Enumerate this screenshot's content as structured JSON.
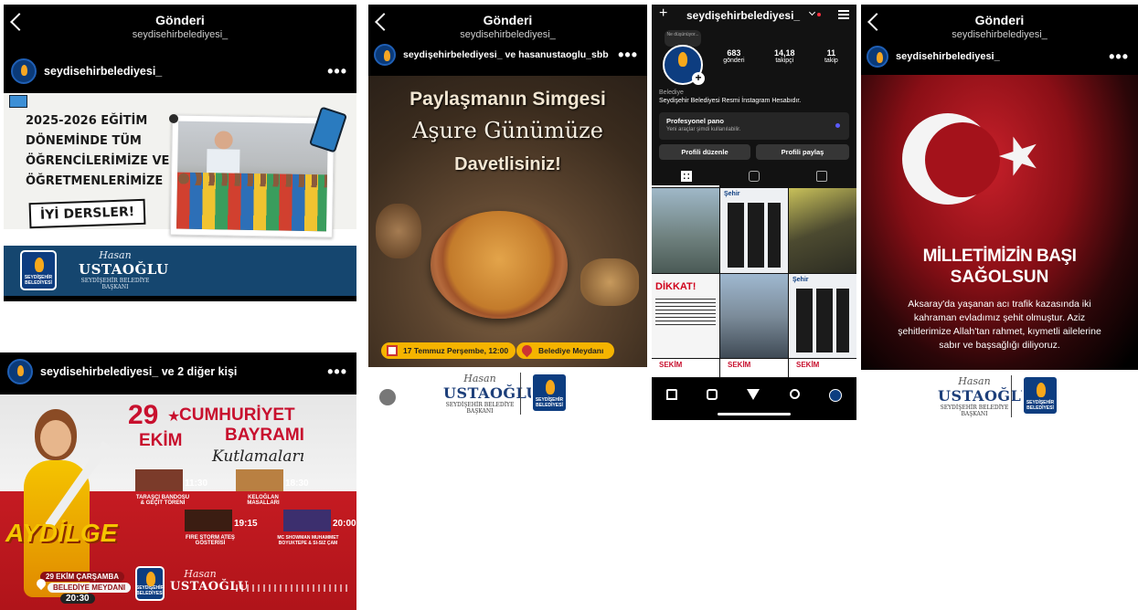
{
  "panel1": {
    "header_title": "Gönderi",
    "header_sub": "seydisehirbelediyesi_",
    "username": "seydisehirbelediyesi_",
    "more": "•••",
    "headline": [
      "2025-2026 EĞİTİM",
      "DÖNEMİNDE TÜM",
      "ÖĞRENCİLERİMİZE VE",
      "ÖĞRETMENLERİMİZE"
    ],
    "banner": "İYİ DERSLER!",
    "logo_text": "SEYDİŞEHİR BELEDİYESİ",
    "sig_hand": "Hasan",
    "sig_name": "USTAOĞLU",
    "sig_title": "SEYDİŞEHİR BELEDİYE BAŞKANI"
  },
  "panel2": {
    "username": "seydisehirbelediyesi_ ve 2 diğer kişi",
    "more": "•••",
    "day": "29",
    "month": "EKİM",
    "title1": "CUMHURİYET",
    "title2": "BAYRAMI",
    "title3": "Kutlamaları",
    "events": [
      {
        "time": "11:30",
        "name": "TARAŞÇI BANDOSU & GEÇİT TÖRENİ"
      },
      {
        "time": "18:30",
        "name": "KELOĞLAN MASALLARI"
      },
      {
        "time": "19:15",
        "name": "FIRE STORM ATEŞ GÖSTERİSİ"
      },
      {
        "time": "20:00",
        "name": "MC SHOWMAN MUHAMMET BOYUKTEPE & SI-SIZ ÇAM"
      }
    ],
    "artist": "AYDİLGE",
    "date_line": "29 EKİM ÇARŞAMBA",
    "place_line": "BELEDİYE MEYDANI",
    "start_time": "20:30",
    "logo_text": "SEYDİŞEHİR BELEDİYESİ",
    "sig_hand": "Hasan",
    "sig_name": "USTAOĞLU"
  },
  "panel3": {
    "header_title": "Gönderi",
    "header_sub": "seydisehirbelediyesi_",
    "username": "seydişehirbelediyesi_ ve hasanustaoglu_sbb",
    "more": "•••",
    "title1": "Paylaşmanın Simgesi",
    "title2": "Aşure Günümüze",
    "title3": "Davetlisiniz!",
    "date_pill": "17 Temmuz Perşembe, 12:00",
    "place_pill": "Belediye Meydanı",
    "sig_hand": "Hasan",
    "sig_name": "USTAOĞLU",
    "sig_title": "SEYDİŞEHİR BELEDİYE BAŞKANI",
    "logo_text": "SEYDİŞEHİR BELEDİYESİ"
  },
  "panel4": {
    "plus": "+",
    "username": "seydişehirbelediyesi_",
    "note": "Ne düşünüyor...",
    "stats": [
      {
        "value": "683",
        "label": "gönderi"
      },
      {
        "value": "14,18",
        "label": "takipçi"
      },
      {
        "value": "11",
        "label": "takip"
      }
    ],
    "category": "Belediye",
    "bio": "Seydişehir Belediyesi Resmi İnstagram Hesabıdır.",
    "pro_title": "Profesyonel pano",
    "pro_sub": "Yeni araçlar şimdi kullanılabilir.",
    "btn_edit": "Profili düzenle",
    "btn_share": "Profili paylaş",
    "grid_dikkat": "DİKKAT!",
    "grid_sehir": "Şehir",
    "grid_sekim": "SEKİM"
  },
  "panel5": {
    "header_title": "Gönderi",
    "header_sub": "seydisehirbelediyesi_",
    "username": "seydisehirbelediyesi_",
    "more": "•••",
    "headline1": "MİLLETİMİZİN BAŞI",
    "headline2": "SAĞOLSUN",
    "body": "Aksaray'da yaşanan acı trafik kazasında iki kahraman evladımız şehit olmuştur. Aziz şehitlerimize Allah'tan rahmet, kıymetli ailelerine sabır ve başsağlığı diliyoruz.",
    "sig_hand": "Hasan",
    "sig_name": "USTAOĞLU",
    "sig_title": "SEYDİŞEHİR BELEDİYE BAŞKANI",
    "logo_text": "SEYDİŞEHİR BELEDİYESİ"
  },
  "colors": {
    "navy": "#0d3d80",
    "turkish_red": "#c8102e",
    "aşure_gold": "#f5b400",
    "pro_dot": "#5b5bff"
  }
}
